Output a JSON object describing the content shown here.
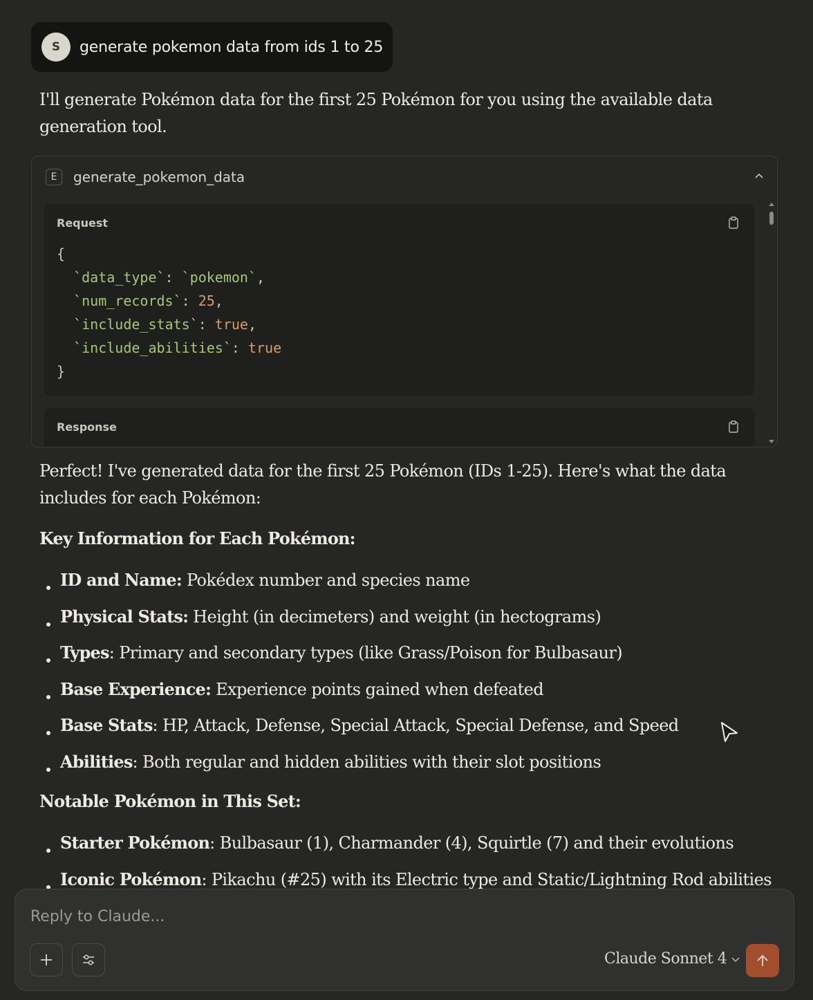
{
  "user_message": {
    "avatar_initial": "S",
    "text": "generate pokemon data from ids 1 to 25"
  },
  "intro": "I'll generate Pokémon data for the first 25 Pokémon for you using the available data generation tool.",
  "tool": {
    "badge": "E",
    "name": "generate_pokemon_data",
    "request_label": "Request",
    "response_label": "Response",
    "request": {
      "open": "{",
      "close": "}",
      "fields": [
        {
          "key": "data_type",
          "value": "`pokemon`"
        },
        {
          "key": "num_records",
          "value": "25"
        },
        {
          "key": "include_stats",
          "value": "true"
        },
        {
          "key": "include_abilities",
          "value": "true"
        }
      ]
    }
  },
  "summary": "Perfect! I've generated data for the first 25 Pokémon (IDs 1-25). Here's what the data includes for each Pokémon:",
  "section1": {
    "heading": "Key Information for Each Pokémon:",
    "items": [
      {
        "term": "ID and Name:",
        "text": " Pokédex number and species name"
      },
      {
        "term": "Physical Stats:",
        "text": " Height (in decimeters) and weight (in hectograms)"
      },
      {
        "term": "Types",
        "text": ": Primary and secondary types (like Grass/Poison for Bulbasaur)"
      },
      {
        "term": "Base Experience:",
        "text": " Experience points gained when defeated"
      },
      {
        "term": "Base Stats",
        "text": ": HP, Attack, Defense, Special Attack, Special Defense, and Speed"
      },
      {
        "term": "Abilities",
        "text": ": Both regular and hidden abilities with their slot positions"
      }
    ]
  },
  "section2": {
    "heading": "Notable Pokémon in This Set:",
    "items": [
      {
        "term": "Starter Pokémon",
        "text": ": Bulbasaur (1), Charmander (4), Squirtle (7) and their evolutions"
      },
      {
        "term": "Iconic Pokémon",
        "text": ": Pikachu (#25) with its Electric type and Static/Lightning Rod abilities"
      }
    ]
  },
  "composer": {
    "placeholder": "Reply to Claude...",
    "model": "Claude Sonnet 4"
  },
  "icons": {
    "collapse": "chevron-up-icon",
    "copy": "clipboard-icon",
    "add": "plus-icon",
    "tools": "sliders-icon",
    "model_dropdown": "chevron-down-icon",
    "send": "arrow-up-icon",
    "cursor": "mouse-pointer-icon"
  },
  "colors": {
    "background": "#262624",
    "accent": "#b5532e",
    "code_key": "#a8c77a",
    "code_value": "#d99a6c"
  }
}
